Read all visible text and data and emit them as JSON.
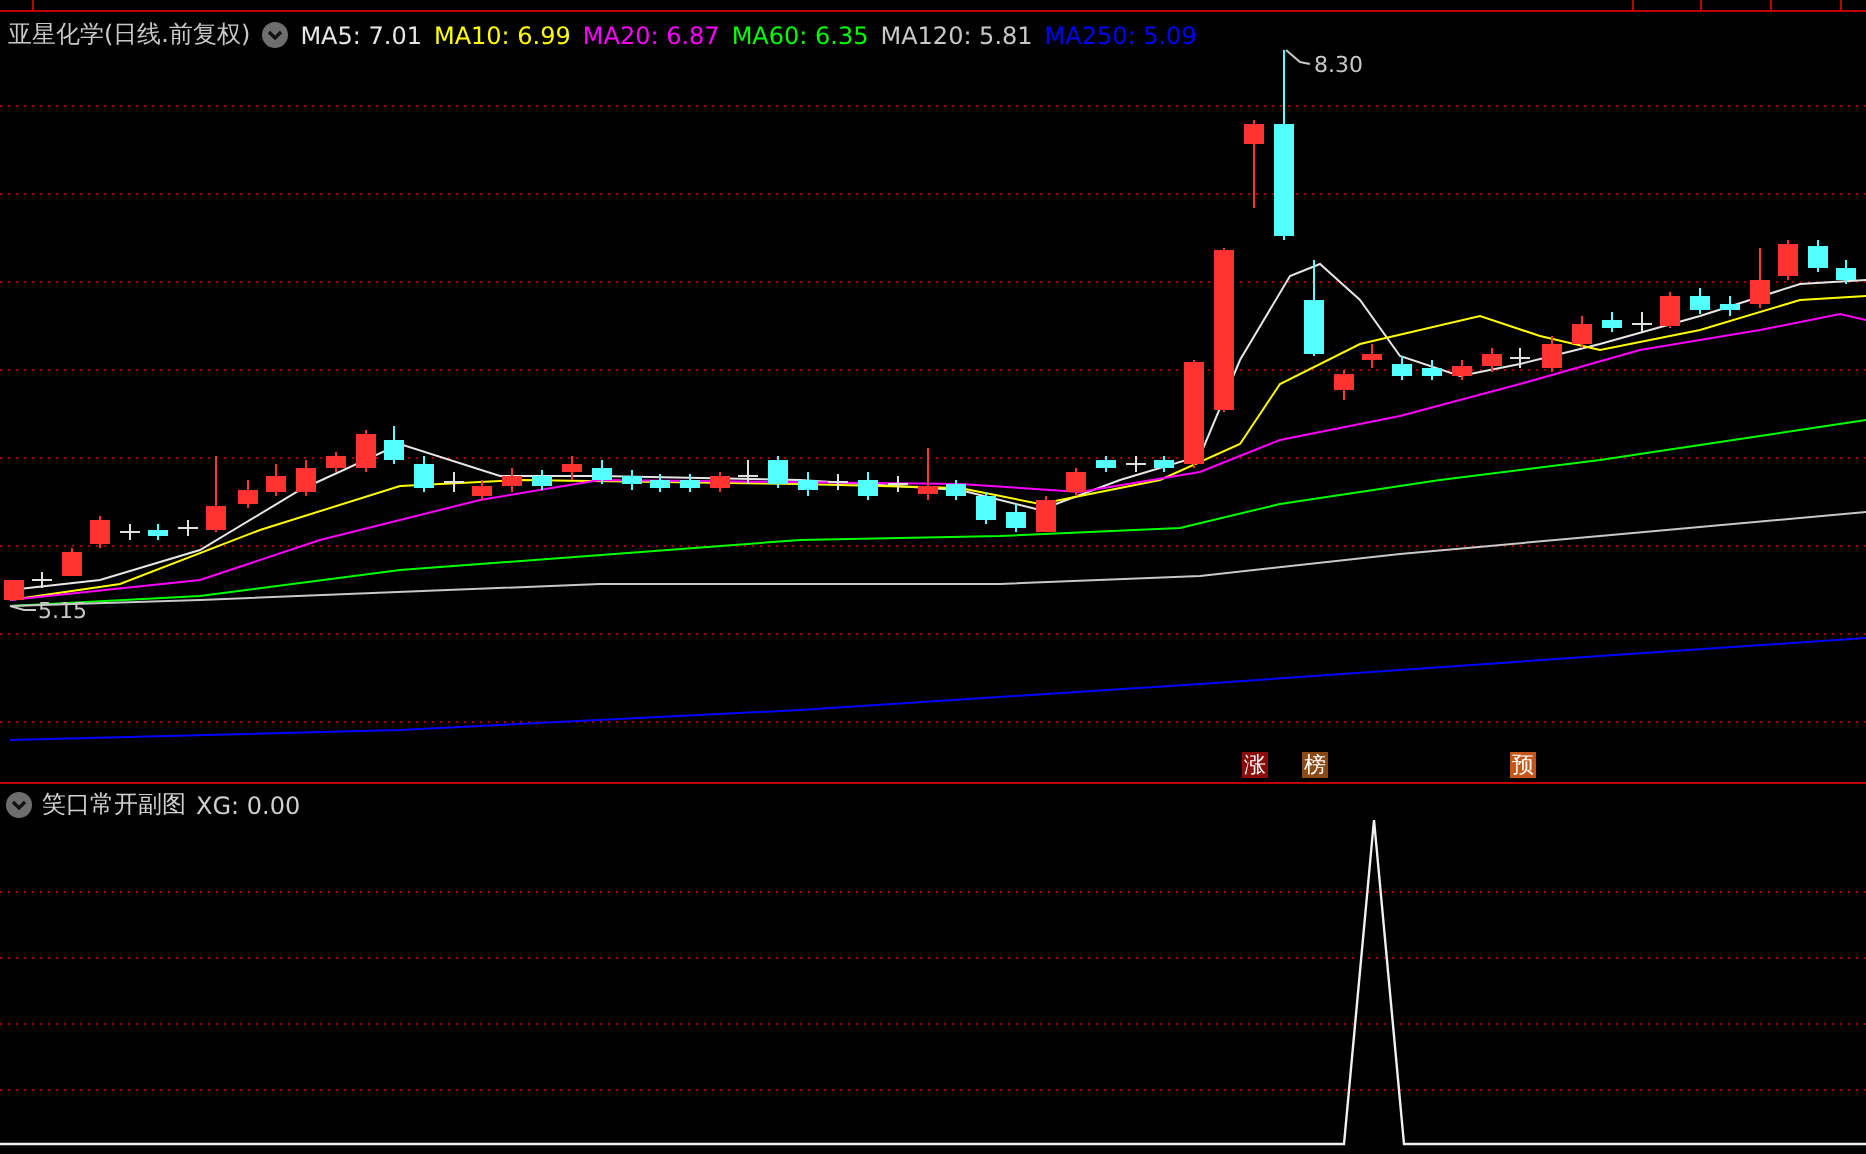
{
  "main_chart": {
    "title": "亚星化学(日线.前复权)",
    "moving_averages": [
      {
        "label": "MA5:",
        "value": "7.01",
        "color": "#e6e6e6"
      },
      {
        "label": "MA10:",
        "value": "6.99",
        "color": "#ffff00"
      },
      {
        "label": "MA20:",
        "value": "6.87",
        "color": "#ff00ff"
      },
      {
        "label": "MA60:",
        "value": "6.35",
        "color": "#00ff00"
      },
      {
        "label": "MA120:",
        "value": "5.81",
        "color": "#c8c8c8"
      },
      {
        "label": "MA250:",
        "value": "5.09",
        "color": "#0000ff"
      }
    ],
    "high_label": "8.30",
    "low_label": "5.15",
    "markers": [
      {
        "text": "涨",
        "color": "#8b0a0a"
      },
      {
        "text": "榜",
        "color": "#8b4a14"
      },
      {
        "text": "预",
        "color": "#c4561a"
      }
    ]
  },
  "sub_chart": {
    "title": "笑口常开副图",
    "indicator": "XG: 0.00"
  }
}
